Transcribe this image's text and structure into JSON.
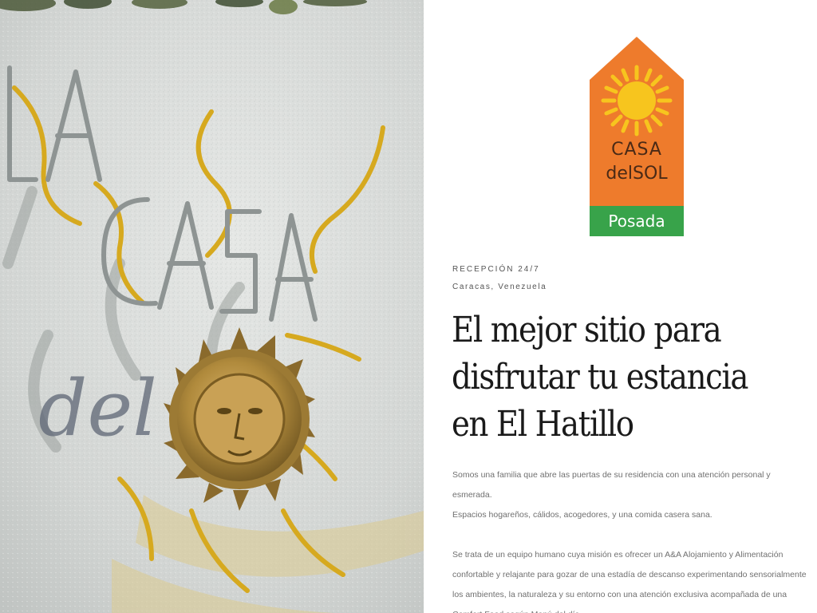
{
  "hero": {
    "sign_letters": "LA CASA",
    "graffiti_text": "del"
  },
  "logo": {
    "brand_top": "CASA",
    "brand_bottom": "delSOL",
    "subtitle": "Posada",
    "colors": {
      "orange": "#EE7B2C",
      "sun": "#F7C51E",
      "green": "#38A34A",
      "text": "#4a2a16"
    }
  },
  "intro": {
    "eyebrow": "RECEPCIÓN 24/7",
    "location": "Caracas, Venezuela",
    "headline": "El mejor sitio para disfrutar tu estancia en El Hatillo",
    "paragraphs": [
      "Somos una familia que abre las puertas de su residencia con una atención personal y esmerada.",
      "Espacios hogareños, cálidos, acogedores, y una comida casera sana.",
      "Se trata de un equipo humano cuya misión es ofrecer un A&A Alojamiento y Alimentación confortable y relajante para gozar de una estadía de descanso experimentando sensorialmente los ambientes, la naturaleza y su entorno con una atención exclusiva acompañada de una Comfort Food según Menú del día."
    ]
  }
}
